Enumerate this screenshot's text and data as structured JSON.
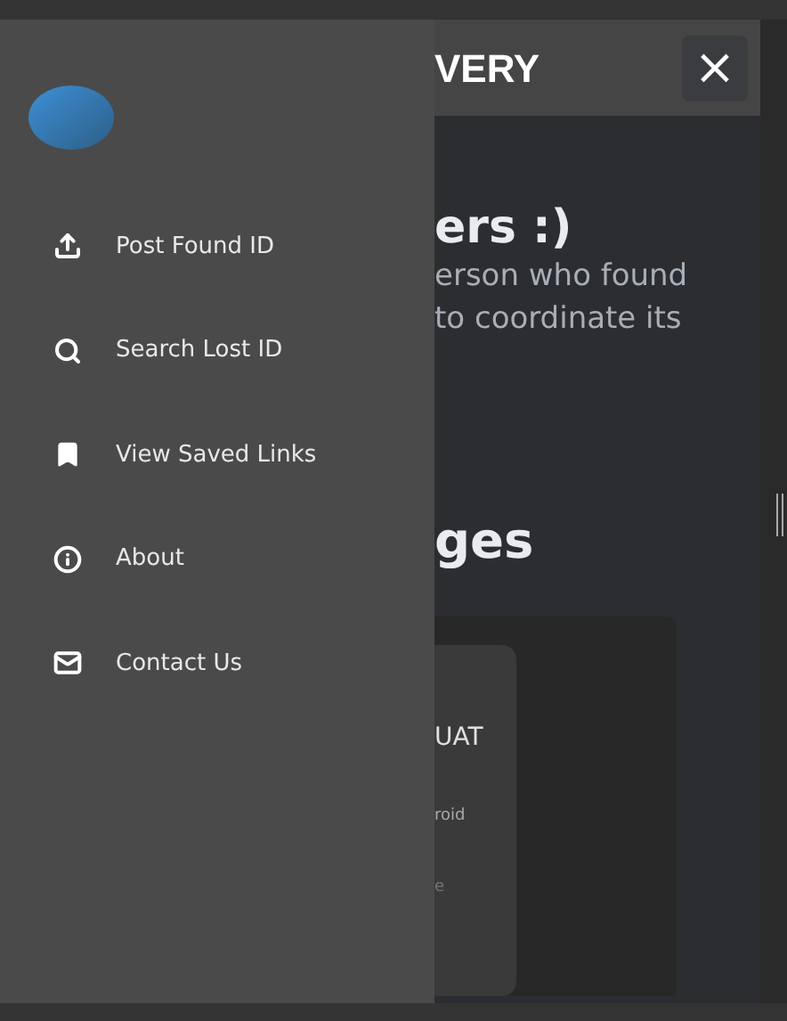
{
  "drawer": {
    "items": [
      {
        "label": "Post Found ID"
      },
      {
        "label": "Search Lost ID"
      },
      {
        "label": "View Saved Links"
      },
      {
        "label": "About"
      },
      {
        "label": "Contact Us"
      }
    ]
  },
  "header": {
    "title": "VERY",
    "close": "×"
  },
  "main": {
    "heading": "ers :)",
    "intro": [
      "erson who found",
      "to coordinate its"
    ],
    "section_heading": "ges",
    "card": {
      "title": "UAT",
      "line_1": "roid",
      "line_2": "e"
    }
  }
}
